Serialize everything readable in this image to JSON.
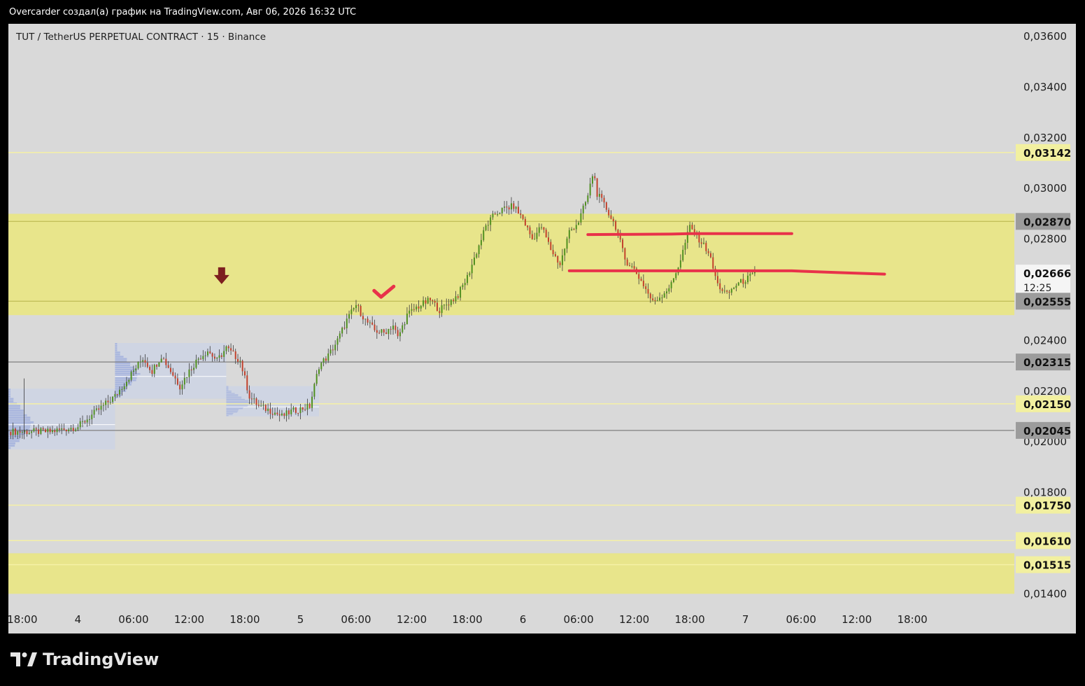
{
  "header": {
    "caption": "Overcarder создал(а) график на TradingView.com, Авг 06, 2026 16:32 UTC"
  },
  "symbol": {
    "title": "TUT / TetherUS PERPETUAL CONTRACT · 15 · Binance"
  },
  "footer": {
    "brand": "TradingView"
  },
  "colors": {
    "background": "#d9d9d9",
    "zone": "#e8e58b",
    "zone_line": "#b6b34a",
    "level_line_yellow": "#f5f0a6",
    "level_line_gray": "#808080",
    "candle_up": "#4f8f1f",
    "candle_down": "#c2402b",
    "wick": "#3a3a3a",
    "drawn_line": "#e8324a",
    "arrow": "#7d1f1f",
    "volume_profile": "#a9b6de",
    "profile_box": "#ccd3e4"
  },
  "chart_data": {
    "type": "candlestick",
    "y_axis": {
      "ticks": [
        "0,03600",
        "0,03400",
        "0,03200",
        "0,03000",
        "0,02800",
        "0,02400",
        "0,02200",
        "0,02000",
        "0,01800",
        "0,01400"
      ],
      "tick_values": [
        0.036,
        0.034,
        0.032,
        0.03,
        0.028,
        0.024,
        0.022,
        0.02,
        0.018,
        0.014
      ],
      "ylim": [
        0.0134,
        0.0365
      ]
    },
    "x_axis": {
      "ticks": [
        "18:00",
        "4",
        "06:00",
        "12:00",
        "18:00",
        "5",
        "06:00",
        "12:00",
        "18:00",
        "6",
        "06:00",
        "12:00",
        "18:00",
        "7",
        "06:00",
        "12:00",
        "18:00"
      ],
      "tick_hours": [
        18,
        24,
        30,
        36,
        42,
        48,
        54,
        60,
        66,
        72,
        78,
        84,
        90,
        96,
        102,
        108,
        114
      ],
      "range_hours": [
        16.5,
        125
      ]
    },
    "price_labels": [
      {
        "text": "0,03142",
        "value": 0.03142,
        "style": "yellow"
      },
      {
        "text": "0,02870",
        "value": 0.0287,
        "style": "gray"
      },
      {
        "text": "0,02666",
        "value": 0.02666,
        "style": "current",
        "sub": "12:25"
      },
      {
        "text": "0,02555",
        "value": 0.02555,
        "style": "gray"
      },
      {
        "text": "0,02315",
        "value": 0.02315,
        "style": "gray"
      },
      {
        "text": "0,02150",
        "value": 0.0215,
        "style": "yellow"
      },
      {
        "text": "0,02045",
        "value": 0.02045,
        "style": "gray"
      },
      {
        "text": "0,01750",
        "value": 0.0175,
        "style": "yellow"
      },
      {
        "text": "0,01610",
        "value": 0.0161,
        "style": "yellow"
      },
      {
        "text": "0,01515",
        "value": 0.01515,
        "style": "yellow"
      }
    ],
    "levels": [
      {
        "value": 0.03142,
        "kind": "yellow"
      },
      {
        "value": 0.0287,
        "kind": "zone"
      },
      {
        "value": 0.02555,
        "kind": "zone"
      },
      {
        "value": 0.02315,
        "kind": "gray"
      },
      {
        "value": 0.0215,
        "kind": "yellow"
      },
      {
        "value": 0.02045,
        "kind": "gray"
      },
      {
        "value": 0.0175,
        "kind": "yellow"
      },
      {
        "value": 0.0161,
        "kind": "yellow"
      },
      {
        "value": 0.01515,
        "kind": "yellow"
      }
    ],
    "zones": [
      {
        "top": 0.029,
        "bottom": 0.025
      },
      {
        "top": 0.0156,
        "bottom": 0.014
      }
    ],
    "price_path": [
      [
        16.5,
        0.0204
      ],
      [
        21,
        0.0204
      ],
      [
        24,
        0.0206
      ],
      [
        26,
        0.0212
      ],
      [
        28,
        0.0218
      ],
      [
        30,
        0.0228
      ],
      [
        31,
        0.0233
      ],
      [
        32,
        0.0228
      ],
      [
        33,
        0.0234
      ],
      [
        34,
        0.0228
      ],
      [
        35,
        0.0222
      ],
      [
        36,
        0.0228
      ],
      [
        37,
        0.0233
      ],
      [
        38,
        0.0236
      ],
      [
        39,
        0.0232
      ],
      [
        40,
        0.0237
      ],
      [
        41.5,
        0.0232
      ],
      [
        42.5,
        0.0218
      ],
      [
        43.5,
        0.0214
      ],
      [
        45,
        0.0212
      ],
      [
        46,
        0.021
      ],
      [
        47,
        0.0212
      ],
      [
        48,
        0.0213
      ],
      [
        49,
        0.0214
      ],
      [
        50,
        0.023
      ],
      [
        51,
        0.0234
      ],
      [
        52,
        0.024
      ],
      [
        53,
        0.0248
      ],
      [
        54,
        0.0254
      ],
      [
        55,
        0.0248
      ],
      [
        56,
        0.0244
      ],
      [
        57,
        0.0243
      ],
      [
        58,
        0.0246
      ],
      [
        58.5,
        0.0241
      ],
      [
        59.5,
        0.025
      ],
      [
        60.5,
        0.0253
      ],
      [
        62,
        0.0256
      ],
      [
        63,
        0.0252
      ],
      [
        65,
        0.0258
      ],
      [
        66,
        0.0265
      ],
      [
        67,
        0.0275
      ],
      [
        68,
        0.0285
      ],
      [
        69,
        0.029
      ],
      [
        70,
        0.0292
      ],
      [
        71,
        0.0293
      ],
      [
        72,
        0.0288
      ],
      [
        73,
        0.028
      ],
      [
        74,
        0.0285
      ],
      [
        75,
        0.0276
      ],
      [
        76,
        0.027
      ],
      [
        77,
        0.0283
      ],
      [
        78,
        0.0287
      ],
      [
        79,
        0.0297
      ],
      [
        79.6,
        0.0307
      ],
      [
        80,
        0.0298
      ],
      [
        81,
        0.0292
      ],
      [
        82,
        0.0285
      ],
      [
        83,
        0.0272
      ],
      [
        84,
        0.0268
      ],
      [
        85,
        0.0262
      ],
      [
        86,
        0.0255
      ],
      [
        87,
        0.0258
      ],
      [
        88,
        0.0262
      ],
      [
        89,
        0.0272
      ],
      [
        90,
        0.0285
      ],
      [
        91,
        0.028
      ],
      [
        92,
        0.0275
      ],
      [
        93,
        0.0262
      ],
      [
        94,
        0.0258
      ],
      [
        95,
        0.0262
      ],
      [
        96,
        0.0264
      ],
      [
        97.2,
        0.02666
      ]
    ],
    "drawn_lines": [
      {
        "points": [
          [
            79,
            0.02818
          ],
          [
            88,
            0.0282
          ],
          [
            90,
            0.02822
          ],
          [
            101,
            0.02822
          ]
        ]
      },
      {
        "points": [
          [
            77,
            0.02675
          ],
          [
            92,
            0.02675
          ],
          [
            101,
            0.02675
          ],
          [
            106,
            0.02668
          ],
          [
            111,
            0.02662
          ]
        ]
      }
    ],
    "volume_profiles": [
      {
        "from": 16.5,
        "to": 28,
        "top": 0.0221,
        "bottom": 0.0197
      },
      {
        "from": 28,
        "to": 40,
        "top": 0.0239,
        "bottom": 0.0217
      },
      {
        "from": 40,
        "to": 50,
        "top": 0.0222,
        "bottom": 0.021
      }
    ],
    "annotations": [
      {
        "type": "arrow-down",
        "x": 39.5,
        "value": 0.0265
      },
      {
        "type": "checkmark",
        "x": 57,
        "value": 0.0258
      }
    ]
  }
}
